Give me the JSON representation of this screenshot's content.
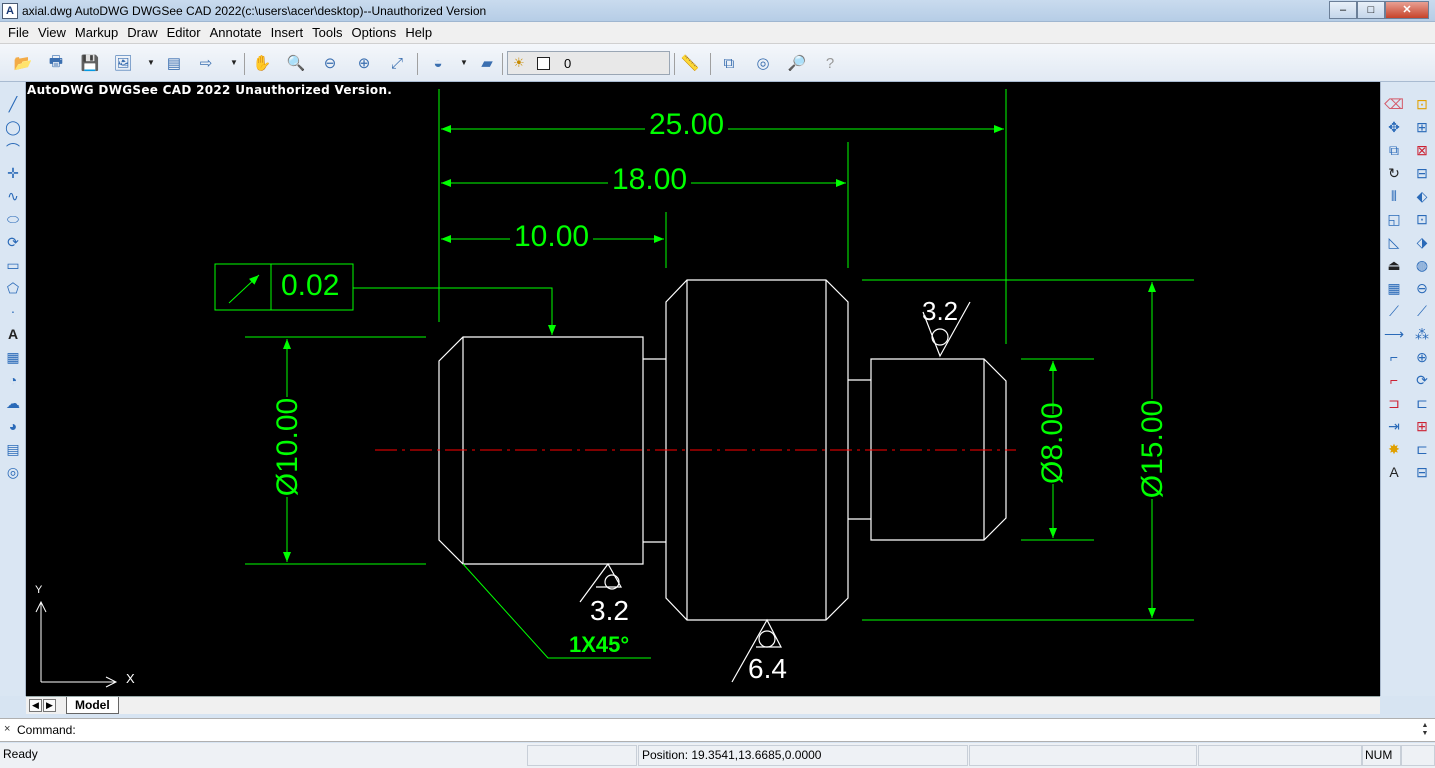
{
  "window": {
    "app_icon": "A",
    "title": "axial.dwg AutoDWG DWGSee CAD 2022(c:\\users\\acer\\desktop)--Unauthorized Version",
    "minimize": "–",
    "maximize": "□",
    "close": "✕"
  },
  "menu": [
    "File",
    "View",
    "Markup",
    "Draw",
    "Editor",
    "Annotate",
    "Insert",
    "Tools",
    "Options",
    "Help"
  ],
  "layer": {
    "name": "0",
    "icon": "layer-lamp-icon"
  },
  "canvas": {
    "watermark": "AutoDWG DWGSee CAD 2022 Unauthorized Version.",
    "dimensions": {
      "d25": "25.00",
      "d18": "18.00",
      "d10": "10.00",
      "tolerance": "0.02",
      "dia10": "Ø10.00",
      "dia8": "Ø8.00",
      "dia15": "Ø15.00",
      "rough1": "3.2",
      "rough2": "3.2",
      "rough3": "6.4",
      "chamfer": "1X45°"
    },
    "ucs_x": "X",
    "ucs_y": "Y",
    "colors": {
      "dimension": "#00ff00",
      "geometry": "#ffffff",
      "centerline": "#ff0000"
    }
  },
  "tabs": {
    "active": "Model"
  },
  "command": {
    "label": "Command:",
    "close": "×"
  },
  "status": {
    "ready": "Ready",
    "position": "Position: 19.3541,13.6685,0.0000",
    "num": "NUM"
  }
}
